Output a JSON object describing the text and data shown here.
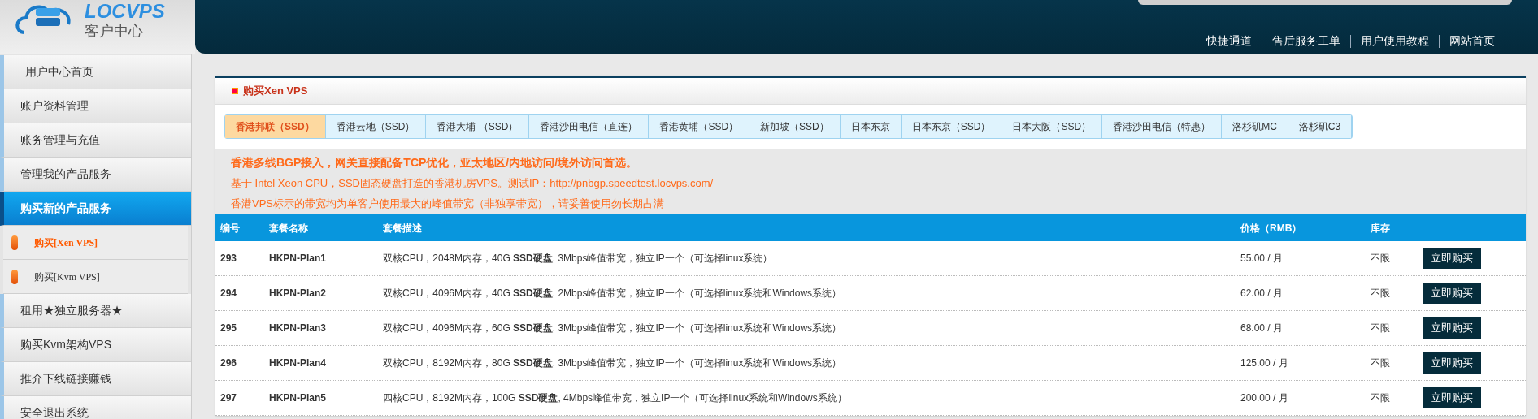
{
  "logo": {
    "brand": "LOCVPS",
    "subtitle": "客户中心"
  },
  "top_nav": [
    "快捷通道",
    "售后服务工单",
    "用户使用教程",
    "网站首页"
  ],
  "sidebar": {
    "items": [
      {
        "label": "用户中心首页",
        "kind": "home",
        "selected": false
      },
      {
        "label": "账户资料管理",
        "kind": "item",
        "selected": false
      },
      {
        "label": "账务管理与充值",
        "kind": "item",
        "selected": false
      },
      {
        "label": "管理我的产品服务",
        "kind": "item",
        "selected": false
      },
      {
        "label": "购买新的产品服务",
        "kind": "item",
        "selected": true
      },
      {
        "label": "购买[Xen VPS]",
        "kind": "sub",
        "selected": true
      },
      {
        "label": "购买[Kvm VPS]",
        "kind": "sub",
        "selected": false
      },
      {
        "label": "租用★独立服务器★",
        "kind": "item",
        "selected": false
      },
      {
        "label": "购买Kvm架构VPS",
        "kind": "item",
        "selected": false
      },
      {
        "label": "推介下线链接赚钱",
        "kind": "item",
        "selected": false
      },
      {
        "label": "安全退出系统",
        "kind": "item",
        "selected": false
      }
    ]
  },
  "panel": {
    "title": "购买Xen VPS",
    "tabs": [
      {
        "label": "香港邦联（SSD）",
        "selected": true
      },
      {
        "label": "香港云地（SSD）",
        "selected": false
      },
      {
        "label": "香港大埔 （SSD）",
        "selected": false
      },
      {
        "label": "香港沙田电信（直连）",
        "selected": false
      },
      {
        "label": "香港黄埔（SSD）",
        "selected": false
      },
      {
        "label": "新加坡（SSD）",
        "selected": false
      },
      {
        "label": "日本东京",
        "selected": false
      },
      {
        "label": "日本东京（SSD）",
        "selected": false
      },
      {
        "label": "日本大阪（SSD）",
        "selected": false
      },
      {
        "label": "香港沙田电信（特惠）",
        "selected": false
      },
      {
        "label": "洛杉矶MC",
        "selected": false
      },
      {
        "label": "洛杉矶C3",
        "selected": false
      }
    ],
    "notes": [
      {
        "text": "香港多线BGP接入，网关直接配备TCP优化，亚太地区/内地访问/境外访问首选。",
        "kind": "headline"
      },
      {
        "text": "基于 Intel Xeon CPU，SSD固态硬盘打造的香港机房VPS。测试IP：http://pnbgp.speedtest.locvps.com/",
        "kind": "line"
      },
      {
        "text": "香港VPS标示的带宽均为单客户使用最大的峰值带宽（非独享带宽），请妥善使用勿长期占满",
        "kind": "line"
      }
    ],
    "table": {
      "columns": [
        "编号",
        "套餐名称",
        "套餐描述",
        "价格（RMB）",
        "库存"
      ],
      "rows": [
        {
          "id": "293",
          "name": "HKPN-Plan1",
          "description": "双核CPU，2048M内存，40G **SSD硬盘**, 3Mbps峰值带宽，独立IP一个（可选择linux系统）",
          "price": "55.00 / 月",
          "stock": "不限",
          "action": "立即购买"
        },
        {
          "id": "294",
          "name": "HKPN-Plan2",
          "description": "双核CPU，4096M内存，40G **SSD硬盘**, 2Mbps峰值带宽，独立IP一个（可选择linux系统和Windows系统）",
          "price": "62.00 / 月",
          "stock": "不限",
          "action": "立即购买"
        },
        {
          "id": "295",
          "name": "HKPN-Plan3",
          "description": "双核CPU，4096M内存，60G **SSD硬盘**, 3Mbps峰值带宽，独立IP一个（可选择linux系统和Windows系统）",
          "price": "68.00 / 月",
          "stock": "不限",
          "action": "立即购买"
        },
        {
          "id": "296",
          "name": "HKPN-Plan4",
          "description": "双核CPU，8192M内存，80G **SSD硬盘**, 3Mbps峰值带宽，独立IP一个（可选择linux系统和Windows系统）",
          "price": "125.00 / 月",
          "stock": "不限",
          "action": "立即购买"
        },
        {
          "id": "297",
          "name": "HKPN-Plan5",
          "description": "四核CPU，8192M内存，100G **SSD硬盘**, 4Mbps峰值带宽，独立IP一个（可选择linux系统和Windows系统）",
          "price": "200.00 / 月",
          "stock": "不限",
          "action": "立即购买"
        }
      ]
    }
  }
}
